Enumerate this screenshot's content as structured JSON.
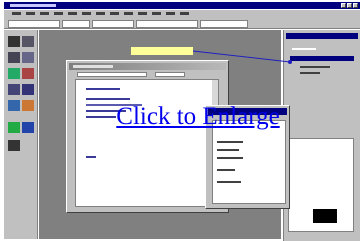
{
  "link": {
    "label": "Click to Enlarge"
  },
  "colors": {
    "title_bar": "#00007f",
    "chrome": "#c0c0c0",
    "workspace": "#808080",
    "link": "#0000ee",
    "tooltip": "#ffff99"
  }
}
